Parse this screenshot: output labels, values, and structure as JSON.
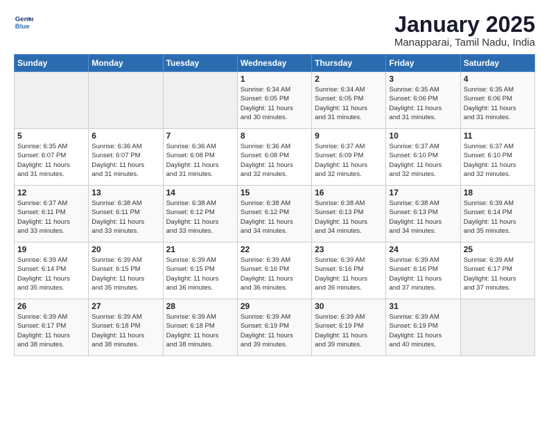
{
  "header": {
    "logo_line1": "General",
    "logo_line2": "Blue",
    "title": "January 2025",
    "subtitle": "Manapparai, Tamil Nadu, India"
  },
  "weekdays": [
    "Sunday",
    "Monday",
    "Tuesday",
    "Wednesday",
    "Thursday",
    "Friday",
    "Saturday"
  ],
  "weeks": [
    [
      {
        "day": "",
        "info": ""
      },
      {
        "day": "",
        "info": ""
      },
      {
        "day": "",
        "info": ""
      },
      {
        "day": "1",
        "info": "Sunrise: 6:34 AM\nSunset: 6:05 PM\nDaylight: 11 hours\nand 30 minutes."
      },
      {
        "day": "2",
        "info": "Sunrise: 6:34 AM\nSunset: 6:05 PM\nDaylight: 11 hours\nand 31 minutes."
      },
      {
        "day": "3",
        "info": "Sunrise: 6:35 AM\nSunset: 6:06 PM\nDaylight: 11 hours\nand 31 minutes."
      },
      {
        "day": "4",
        "info": "Sunrise: 6:35 AM\nSunset: 6:06 PM\nDaylight: 11 hours\nand 31 minutes."
      }
    ],
    [
      {
        "day": "5",
        "info": "Sunrise: 6:35 AM\nSunset: 6:07 PM\nDaylight: 11 hours\nand 31 minutes."
      },
      {
        "day": "6",
        "info": "Sunrise: 6:36 AM\nSunset: 6:07 PM\nDaylight: 11 hours\nand 31 minutes."
      },
      {
        "day": "7",
        "info": "Sunrise: 6:36 AM\nSunset: 6:08 PM\nDaylight: 11 hours\nand 31 minutes."
      },
      {
        "day": "8",
        "info": "Sunrise: 6:36 AM\nSunset: 6:08 PM\nDaylight: 11 hours\nand 32 minutes."
      },
      {
        "day": "9",
        "info": "Sunrise: 6:37 AM\nSunset: 6:09 PM\nDaylight: 11 hours\nand 32 minutes."
      },
      {
        "day": "10",
        "info": "Sunrise: 6:37 AM\nSunset: 6:10 PM\nDaylight: 11 hours\nand 32 minutes."
      },
      {
        "day": "11",
        "info": "Sunrise: 6:37 AM\nSunset: 6:10 PM\nDaylight: 11 hours\nand 32 minutes."
      }
    ],
    [
      {
        "day": "12",
        "info": "Sunrise: 6:37 AM\nSunset: 6:11 PM\nDaylight: 11 hours\nand 33 minutes."
      },
      {
        "day": "13",
        "info": "Sunrise: 6:38 AM\nSunset: 6:11 PM\nDaylight: 11 hours\nand 33 minutes."
      },
      {
        "day": "14",
        "info": "Sunrise: 6:38 AM\nSunset: 6:12 PM\nDaylight: 11 hours\nand 33 minutes."
      },
      {
        "day": "15",
        "info": "Sunrise: 6:38 AM\nSunset: 6:12 PM\nDaylight: 11 hours\nand 34 minutes."
      },
      {
        "day": "16",
        "info": "Sunrise: 6:38 AM\nSunset: 6:13 PM\nDaylight: 11 hours\nand 34 minutes."
      },
      {
        "day": "17",
        "info": "Sunrise: 6:38 AM\nSunset: 6:13 PM\nDaylight: 11 hours\nand 34 minutes."
      },
      {
        "day": "18",
        "info": "Sunrise: 6:39 AM\nSunset: 6:14 PM\nDaylight: 11 hours\nand 35 minutes."
      }
    ],
    [
      {
        "day": "19",
        "info": "Sunrise: 6:39 AM\nSunset: 6:14 PM\nDaylight: 11 hours\nand 35 minutes."
      },
      {
        "day": "20",
        "info": "Sunrise: 6:39 AM\nSunset: 6:15 PM\nDaylight: 11 hours\nand 35 minutes."
      },
      {
        "day": "21",
        "info": "Sunrise: 6:39 AM\nSunset: 6:15 PM\nDaylight: 11 hours\nand 36 minutes."
      },
      {
        "day": "22",
        "info": "Sunrise: 6:39 AM\nSunset: 6:16 PM\nDaylight: 11 hours\nand 36 minutes."
      },
      {
        "day": "23",
        "info": "Sunrise: 6:39 AM\nSunset: 6:16 PM\nDaylight: 11 hours\nand 36 minutes."
      },
      {
        "day": "24",
        "info": "Sunrise: 6:39 AM\nSunset: 6:16 PM\nDaylight: 11 hours\nand 37 minutes."
      },
      {
        "day": "25",
        "info": "Sunrise: 6:39 AM\nSunset: 6:17 PM\nDaylight: 11 hours\nand 37 minutes."
      }
    ],
    [
      {
        "day": "26",
        "info": "Sunrise: 6:39 AM\nSunset: 6:17 PM\nDaylight: 11 hours\nand 38 minutes."
      },
      {
        "day": "27",
        "info": "Sunrise: 6:39 AM\nSunset: 6:18 PM\nDaylight: 11 hours\nand 38 minutes."
      },
      {
        "day": "28",
        "info": "Sunrise: 6:39 AM\nSunset: 6:18 PM\nDaylight: 11 hours\nand 38 minutes."
      },
      {
        "day": "29",
        "info": "Sunrise: 6:39 AM\nSunset: 6:19 PM\nDaylight: 11 hours\nand 39 minutes."
      },
      {
        "day": "30",
        "info": "Sunrise: 6:39 AM\nSunset: 6:19 PM\nDaylight: 11 hours\nand 39 minutes."
      },
      {
        "day": "31",
        "info": "Sunrise: 6:39 AM\nSunset: 6:19 PM\nDaylight: 11 hours\nand 40 minutes."
      },
      {
        "day": "",
        "info": ""
      }
    ]
  ]
}
